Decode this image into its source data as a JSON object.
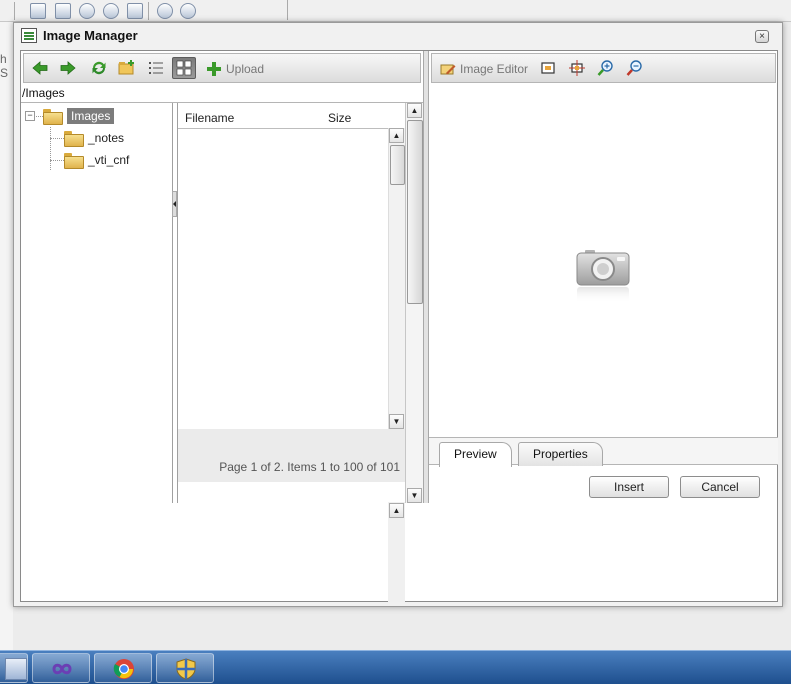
{
  "background": {
    "left_text": "h S"
  },
  "dialog": {
    "title": "Image Manager",
    "close_label": "×"
  },
  "toolbar": {
    "upload_label": "Upload",
    "image_editor_label": "Image Editor"
  },
  "path": "/Images",
  "tree": {
    "toggle": "−",
    "root": "Images",
    "children": [
      "_notes",
      "_vti_cnf"
    ]
  },
  "file_list": {
    "columns": [
      "Filename",
      "Size"
    ],
    "pager_text": "Page 1 of 2. Items 1 to 100 of 101"
  },
  "tabs": [
    "Preview",
    "Properties"
  ],
  "buttons": {
    "insert": "Insert",
    "cancel": "Cancel"
  },
  "colors": {
    "accent_green": "#3a9a2a",
    "selection": "#7c7c7c",
    "taskbar": "#2a5ea0"
  }
}
